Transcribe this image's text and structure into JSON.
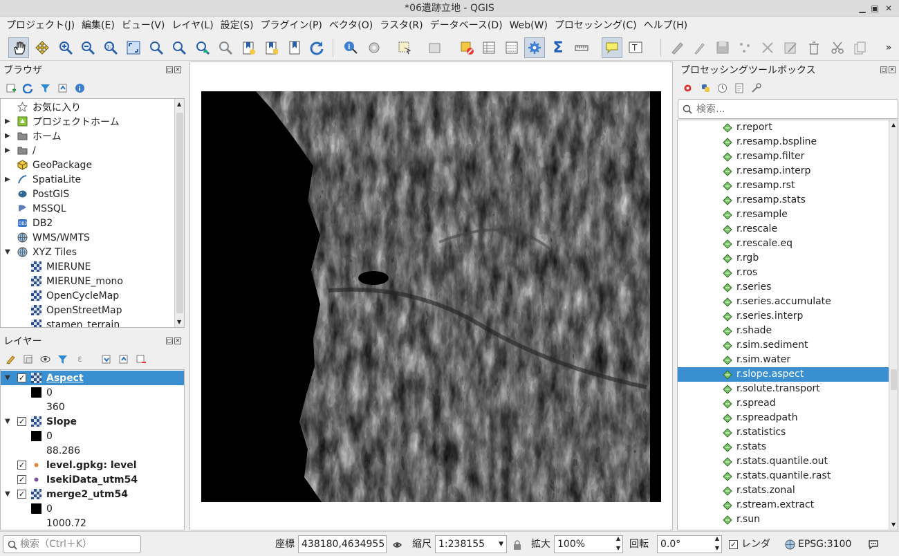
{
  "window": {
    "title": "*06遺跡立地 - QGIS"
  },
  "menu": [
    "プロジェクト(J)",
    "編集(E)",
    "ビュー(V)",
    "レイヤ(L)",
    "設定(S)",
    "プラグイン(P)",
    "ベクタ(O)",
    "ラスタ(R)",
    "データベース(D)",
    "Web(W)",
    "プロセッシング(C)",
    "ヘルプ(H)"
  ],
  "browser": {
    "title": "ブラウザ",
    "items": [
      {
        "label": "お気に入り",
        "icon": "star-icon",
        "expandable": false
      },
      {
        "label": "プロジェクトホーム",
        "icon": "project-home-icon",
        "expandable": true
      },
      {
        "label": "ホーム",
        "icon": "folder-icon",
        "expandable": true
      },
      {
        "label": "/",
        "icon": "folder-icon",
        "expandable": true
      },
      {
        "label": "GeoPackage",
        "icon": "geopackage-icon",
        "expandable": false
      },
      {
        "label": "SpatiaLite",
        "icon": "spatialite-icon",
        "expandable": true
      },
      {
        "label": "PostGIS",
        "icon": "postgis-icon",
        "expandable": false
      },
      {
        "label": "MSSQL",
        "icon": "mssql-icon",
        "expandable": false
      },
      {
        "label": "DB2",
        "icon": "db2-icon",
        "expandable": false
      },
      {
        "label": "WMS/WMTS",
        "icon": "globe-icon",
        "expandable": false
      },
      {
        "label": "XYZ Tiles",
        "icon": "globe-icon",
        "expandable": true,
        "expanded": true
      },
      {
        "label": "MIERUNE",
        "icon": "tile-icon",
        "child": true
      },
      {
        "label": "MIERUNE_mono",
        "icon": "tile-icon",
        "child": true
      },
      {
        "label": "OpenCycleMap",
        "icon": "tile-icon",
        "child": true
      },
      {
        "label": "OpenStreetMap",
        "icon": "tile-icon",
        "child": true
      },
      {
        "label": "stamen_terrain",
        "icon": "tile-icon",
        "child": true
      }
    ]
  },
  "layers": {
    "title": "レイヤー",
    "items": [
      {
        "name": "Aspect",
        "kind": "raster",
        "checked": true,
        "expanded": true,
        "selected": true,
        "min": "0",
        "max": "360"
      },
      {
        "name": "Slope",
        "kind": "raster",
        "checked": true,
        "expanded": true,
        "min": "0",
        "max": "88.286"
      },
      {
        "name": "level.gpkg: level",
        "kind": "point",
        "checked": true,
        "point_color": "#e08a3c"
      },
      {
        "name": "IsekiData_utm54",
        "kind": "point",
        "checked": true,
        "point_color": "#7b4f9e"
      },
      {
        "name": "merge2_utm54",
        "kind": "raster",
        "checked": true,
        "expanded": true,
        "min": "0",
        "max": "1000.72"
      }
    ]
  },
  "processing": {
    "title": "プロセッシングツールボックス",
    "search_placeholder": "検索...",
    "items": [
      "r.report",
      "r.resamp.bspline",
      "r.resamp.filter",
      "r.resamp.interp",
      "r.resamp.rst",
      "r.resamp.stats",
      "r.resample",
      "r.rescale",
      "r.rescale.eq",
      "r.rgb",
      "r.ros",
      "r.series",
      "r.series.accumulate",
      "r.series.interp",
      "r.shade",
      "r.sim.sediment",
      "r.sim.water",
      "r.slope.aspect",
      "r.solute.transport",
      "r.spread",
      "r.spreadpath",
      "r.statistics",
      "r.stats",
      "r.stats.quantile.out",
      "r.stats.quantile.rast",
      "r.stats.zonal",
      "r.stream.extract",
      "r.sun"
    ],
    "selected": "r.slope.aspect"
  },
  "status": {
    "locator_placeholder": "検索（Ctrl＋K）",
    "coord_label": "座標",
    "coord_value": "438180,4634955",
    "scale_label": "縮尺",
    "scale_value": "1:238155",
    "magnify_label": "拡大",
    "magnify_value": "100%",
    "rotation_label": "回転",
    "rotation_value": "0.0°",
    "render_label": "レンダ",
    "crs_label": "EPSG:3100"
  },
  "colors": {
    "selection": "#3a8fd0",
    "accent": "#2d4d8e"
  }
}
